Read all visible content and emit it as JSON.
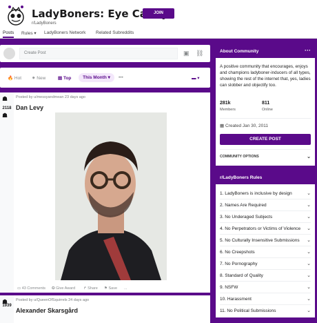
{
  "header": {
    "title": "LadyBoners: Eye Candy!",
    "subreddit": "r/LadyBoners",
    "join_label": "JOIN"
  },
  "nav": {
    "tabs": [
      "Posts",
      "Rules",
      "LadyBoners Network",
      "Related Subreddits"
    ]
  },
  "create_post": {
    "placeholder": "Create Post"
  },
  "sort": {
    "options": [
      "Hot",
      "New",
      "Top"
    ],
    "active": "Top",
    "time_filter": "This Month"
  },
  "posts": [
    {
      "votes": "2118",
      "meta": "Posted by u/messyandmean 23 days ago",
      "title": "Dan Levy",
      "actions": [
        "43 Comments",
        "Give Award",
        "Share",
        "Save",
        "..."
      ]
    },
    {
      "votes": "1939",
      "meta": "Posted by u/QueenOfSquirrels 24 days ago",
      "title": "Alexander Skarsgård"
    }
  ],
  "about": {
    "heading": "About Community",
    "description": "A positive community that encourages, enjoys and champions ladyboner-inducers of all types, showing the rest of the internet that, yes, ladies can slobber and objectify too.",
    "members": "281k",
    "members_label": "Members",
    "online": "811",
    "online_label": "Online",
    "created": "Created Jan 30, 2011",
    "create_post_label": "CREATE POST",
    "community_options": "COMMUNITY OPTIONS"
  },
  "rules": {
    "heading": "r/LadyBoners Rules",
    "items": [
      "1. LadyBoners is inclusive by design",
      "2. Names Are Required",
      "3. No Underaged Subjects",
      "4. No Perpetrators or Victims of Violence",
      "5. No Culturally Insensitive Submissions",
      "6. No Creepshots",
      "7. No Pornography",
      "8. Standard of Quality",
      "9. NSFW",
      "10. Harassment",
      "11. No Political Submissions"
    ]
  },
  "colors": {
    "accent": "#5a0a8a",
    "background": "#5a0a8a"
  }
}
